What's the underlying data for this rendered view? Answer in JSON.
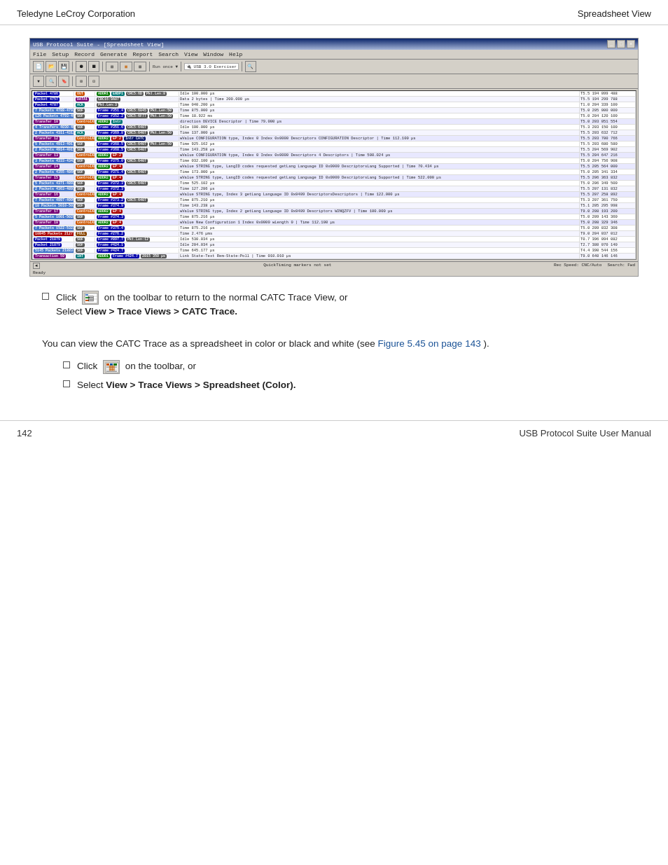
{
  "header": {
    "left": "Teledyne LeCroy Corporation",
    "right": "Spreadsheet View"
  },
  "screenshot": {
    "title": "USB Protocol Suite - [Spreadsheet View]",
    "menu_items": [
      "File",
      "Setup",
      "Record",
      "Generate",
      "Report",
      "Search",
      "View",
      "Window",
      "Help"
    ],
    "rows": [
      {
        "num": "Packet 4786",
        "type": "OUT",
        "badges": [
          "ADDR1",
          "ENDP1",
          "CRC5:6D",
          "Pkt.Len:8"
        ],
        "desc": "Idle 100.000 µs",
        "time": "T5.5  194 099 488"
      },
      {
        "num": "Packet 4787",
        "type": "DATA1",
        "badges": [
          "CRC16:9A07"
        ],
        "desc": "Data 2 bytes | Time 200.000 µs",
        "time": "T5.5  194 299 788"
      },
      {
        "num": "Packet 4787",
        "type": "ACK",
        "badges": [
          "Pkt.Len:3"
        ],
        "desc": "Time 040.200 µs",
        "time": "T1.0  204 339 100"
      },
      {
        "num": "7 Packets 4788-4792",
        "type": "SOF",
        "badges": [
          "Frame #351.4",
          "CRC5:6045",
          "Pkt.Len:50"
        ],
        "desc": "Time 875.000 µs",
        "time": "T5.0  205 000 000"
      },
      {
        "num": "126 Packets 4793-4918",
        "type": "SOF",
        "badges": [
          "Frame #352.2",
          "CRC5:6F77",
          "Pkt.Len:50"
        ],
        "desc": "Time 18.922 ms",
        "time": "T5.0  204 120 100"
      },
      {
        "num": "Transfer 10",
        "type": "ControlXFR",
        "badges": [
          "ADDR2",
          "Interrupt direction DEVICE Descriptor"
        ],
        "desc": "Time 79.000 µs",
        "time": "T5.0  203 051 554"
      },
      {
        "num": "4 Transfers 4030-4033",
        "type": "SOF",
        "badges": [
          "Frame #351.6",
          "CRC5:6407"
        ],
        "desc": "Idle 100.000 µs",
        "time": "T5.3  203 150 100"
      },
      {
        "num": "2 Packets 4311-4312",
        "type": "ACK",
        "badges": [
          "Frame #369.8",
          "CRC5:6407",
          "Pkt.Len:50"
        ],
        "desc": "Time 137.000 µs",
        "time": "T5.5  203 632 712"
      },
      {
        "num": "Transfer 12",
        "type": "ControlXFR",
        "badges": [
          "ADDR2",
          "EP:2",
          "Interrupt CATC:AMFD0"
        ],
        "desc": "wValue CONFIGURATION type, Index 0 Index 0x0000 Descriptors CONFIGURATION Descriptor",
        "time": "Time 112.100 µs | T5.5  203 700 766"
      },
      {
        "num": "5 Packets 4913-4917",
        "type": "SOF",
        "badges": [
          "Frame #368.5",
          "CRC5:6407",
          "Pkt.Len:50"
        ],
        "desc": "Time 925.162 µs",
        "time": "T5.5  203 680 580"
      },
      {
        "num": "2 Packets 4914-4915",
        "type": "SOF",
        "badges": [
          "Frame #368.5",
          "CRC5:6407",
          "Pkt.Len:50"
        ],
        "desc": "Time 143.258 µs",
        "time": "T5.5  204 569 902"
      },
      {
        "num": "Transfer 13",
        "type": "ControlXFR",
        "badges": [
          "ADDR2",
          "EP:2",
          "Interrupt CATC:AMFD0"
        ],
        "desc": "wValue CONFIGURATION type, Index 0 Index 0x0000 Descriptors 4 Descriptors",
        "time": "Time 500.024 µs | T5.5  204 647 216"
      },
      {
        "num": "3 Packets 4333-4342",
        "type": "SOF",
        "badges": [
          "Frame #375.0",
          "CRC5:6407",
          "Pkt.Len:50"
        ],
        "desc": "Time 032.100 µs",
        "time": "T5.0  204 756 908"
      },
      {
        "num": "Transfer 14",
        "type": "ControlXFR",
        "badges": [
          "ADDR2",
          "EP:4",
          "Interrupt CATC:AMFD0"
        ],
        "desc": "wValue STRING type, LangID codes requested getLang Language ID 0x0000 DescriptorsLang Supported",
        "time": "Time 70.434 µs | T5.5  205 564 000"
      },
      {
        "num": "2 Packets 4355-4860",
        "type": "SOF",
        "badges": [
          "Frame #371.4",
          "CRC5:6407",
          "Pkt.Len:50"
        ],
        "desc": "Time 173.000 µs",
        "time": "T5.0  205 341 334"
      },
      {
        "num": "Transfer 15",
        "type": "ControlXFR",
        "badges": [
          "ADDR2",
          "EP:4",
          "Interrupt CATC:AMFD0"
        ],
        "desc": "wValue STRING type, LangID codes requested getLang Language ID 0x0000 DescriptorsLang Supported",
        "time": "Time 522.000 µs | T5.5  206 363 832"
      },
      {
        "num": "5 Packets 4371-4892",
        "type": "SOF",
        "badges": [
          "Frame #372.3",
          "CRC5:6407",
          "Pkt.Len:50"
        ],
        "desc": "Time 525.102 µs",
        "time": "T5.0  206 349 500"
      },
      {
        "num": "2 Packets 4363-4893",
        "type": "SOF",
        "badges": [
          "Frame #372.3",
          "CRC5:6407",
          "Pkt.Len:50"
        ],
        "desc": "Time 127.286 µs",
        "time": "T5.5  207 131 832"
      },
      {
        "num": "Transfer 16",
        "type": "ControlXFR",
        "badges": [
          "ADDR2",
          "EP:4",
          "Interrupt CATC:AMFD0"
        ],
        "desc": "wValue STRING type, Index 3 getLang Language ID 0x0409 DescriptorsDescriptors",
        "time": "Time 122.000 µs | T5.5  207 258 892"
      },
      {
        "num": "7 Packets 4997-4999",
        "type": "SOF",
        "badges": [
          "Frame #373.2",
          "CRC5:6407",
          "Pkt.Len:50"
        ],
        "desc": "Time 875.210 µs",
        "time": "T5.3  207 361 750"
      },
      {
        "num": "10 Packets 5010-5020",
        "type": "SOF",
        "badges": [
          "Frame #374.9",
          "CRC5:6407",
          "Pkt.Len:50"
        ],
        "desc": "Time 143.238 µs",
        "time": "T5.1  205 295 998"
      },
      {
        "num": "Transfer 17",
        "type": "ControlXFR",
        "badges": [
          "ADDR2",
          "EP:4",
          "Interrupt CATC:AMFD0"
        ],
        "desc": "wValue STRING type, Index 2 getLang Language ID 0x0409 Descriptors W2NQZFV",
        "time": "Time 100.000 µs | T9.0  208 193 200"
      },
      {
        "num": "5 Packets 1001-5028",
        "type": "SOF",
        "badges": [
          "Frame #374.3",
          "CRC5:6407",
          "Pkt.Len:50"
        ],
        "desc": "Time 875.216 µs",
        "time": "T5.0  209 143 360"
      },
      {
        "num": "Transfer 18",
        "type": "ControlXFR",
        "badges": [
          "ADDR2",
          "EP:4",
          "Interrupt CATC:AMFD0"
        ],
        "desc": "wValue New Configuration 1 lndex 0x0000 wLength 0",
        "time": "Time 112.100 µs | T5.0  208 329 346"
      },
      {
        "num": "7 Packets 1522-5322",
        "type": "SOF",
        "badges": [
          "Frame #375.4",
          "CRC5:6407",
          "Pkt.Len:50"
        ],
        "desc": "Time 875.216 µs",
        "time": "T5.0  209 832 308"
      },
      {
        "num": "10845 Packets 21277",
        "type": "FULL",
        "badges": [
          "Frame #276.2",
          "CRC5:6407",
          "Pkt.Len:50"
        ],
        "desc": "Time 2.476 µms | T9.0  204 037 012"
      },
      {
        "num": "Packet 21879",
        "type": "SOF",
        "badges": [
          "Frame #897.7",
          "CRC5:6407",
          "Pkt.Len:12"
        ],
        "desc": "Idle 530.034 µs",
        "time": "T0.7  396 094 082"
      },
      {
        "num": "Packet 21879",
        "type": "SOF",
        "badges": [
          "Frame #424.1",
          "CRC5:6407",
          "Pkt.Len:50"
        ],
        "desc": "Idle 204.034 µs",
        "time": "T2.7  380 070 140"
      },
      {
        "num": "5145 Packets 21883-21924",
        "type": "SOF",
        "badges": [
          "Frame #424.7",
          "CRC5:6407",
          "Pkt.Len:50"
        ],
        "desc": "Time 645.177 µs",
        "time": "T4.4  390 544 156"
      },
      {
        "num": "Transaction 59",
        "type": "INT",
        "badges": [
          "ADDR1",
          "1",
          "Frame #424.7",
          "2815 350 µs, Link State-Text",
          "Rem-State:Poll"
        ],
        "desc": "Time 010.010 µs",
        "time": "T9.0  640 146 146"
      }
    ]
  },
  "instruction1": {
    "bullet": "□",
    "pre_text": "Click",
    "icon_alt": "toolbar icon",
    "post_text": "on the toolbar to return to the normal CATC Trace View, or",
    "second_line": "Select",
    "menu_path": "View > Trace Views > CATC Trace."
  },
  "body_text": "You can view the CATC Trace as a spreadsheet in color or black and white (see",
  "figure_link": "Figure 5.45",
  "figure_page": "on page 143",
  "body_text_end": ").",
  "instruction2_1": {
    "pre_text": "Click",
    "icon_alt": "color toolbar icon",
    "post_text": "on the toolbar, or"
  },
  "instruction2_2": {
    "pre_text": "Select",
    "menu_path": "View > Trace Views > Spreadsheet (Color)."
  },
  "footer": {
    "page_number": "142",
    "title": "USB Protocol Suite User Manual"
  }
}
